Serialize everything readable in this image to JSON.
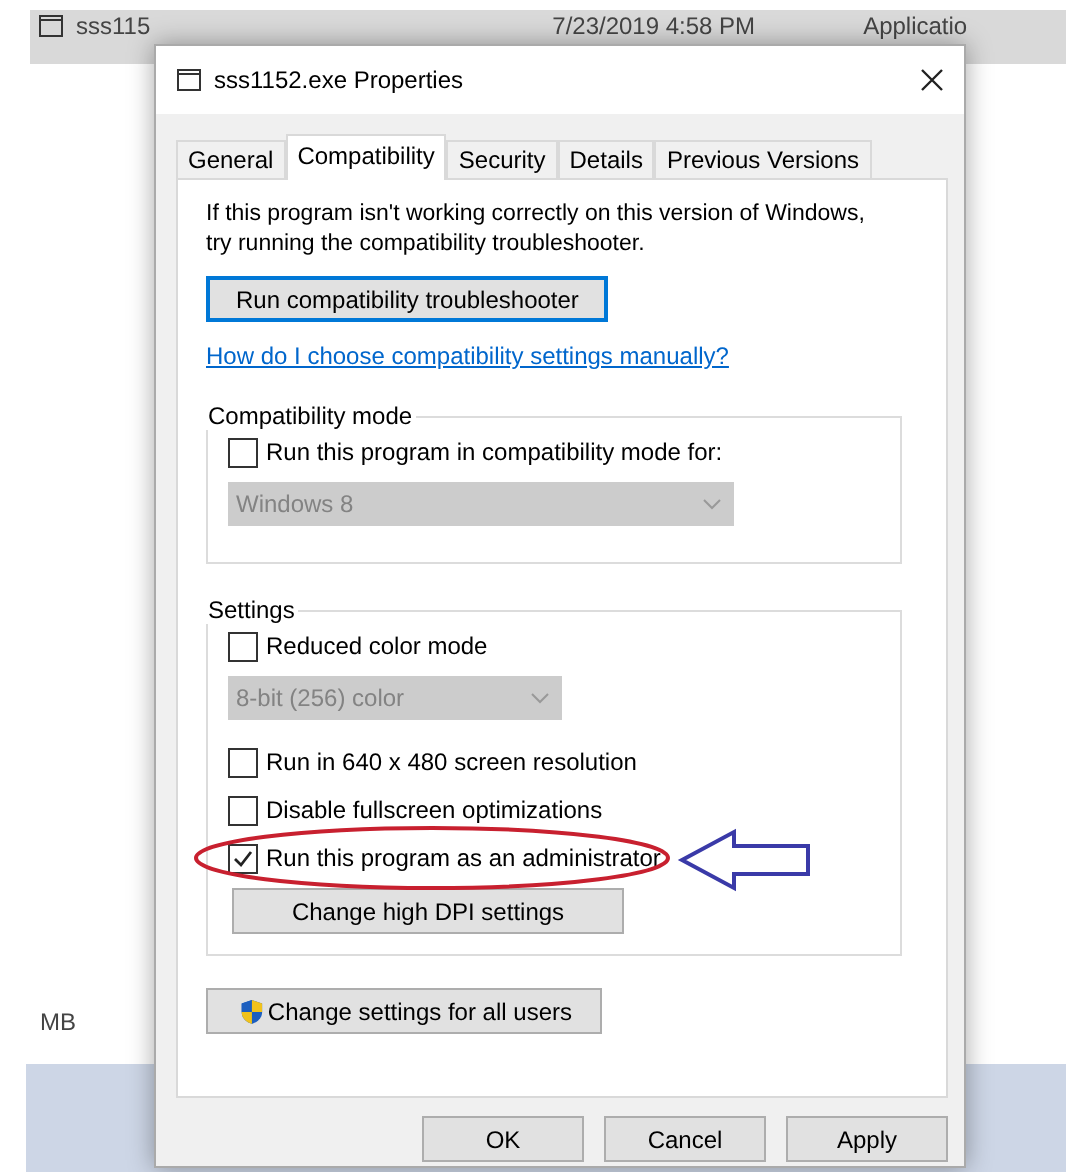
{
  "background": {
    "file_name": "sss115",
    "date_modified": "7/23/2019 4:58 PM",
    "type": "Applicatio",
    "size": "MB"
  },
  "dialog": {
    "title": "sss1152.exe Properties",
    "tabs": [
      {
        "label": "General",
        "selected": false
      },
      {
        "label": "Compatibility",
        "selected": true
      },
      {
        "label": "Security",
        "selected": false
      },
      {
        "label": "Details",
        "selected": false
      },
      {
        "label": "Previous Versions",
        "selected": false
      }
    ],
    "intro": "If this program isn't working correctly on this version of Windows, try running the compatibility troubleshooter.",
    "troubleshooter_button": {
      "label": "Run compatibility troubleshooter",
      "focused": true
    },
    "help_link": "How do I choose compatibility settings manually?",
    "compatibility_mode": {
      "title": "Compatibility mode",
      "checkbox": {
        "label": "Run this program in compatibility mode for:",
        "checked": false
      },
      "dropdown": {
        "value": "Windows 8",
        "disabled": true
      }
    },
    "settings": {
      "title": "Settings",
      "items": [
        {
          "kind": "checkbox",
          "label": "Reduced color mode",
          "checked": false
        },
        {
          "kind": "dropdown",
          "value": "8-bit (256) color",
          "disabled": true
        },
        {
          "kind": "checkbox",
          "label": "Run in 640 x 480 screen resolution",
          "checked": false
        },
        {
          "kind": "checkbox",
          "label": "Disable fullscreen optimizations",
          "checked": false
        },
        {
          "kind": "checkbox",
          "label": "Run this program as an administrator",
          "checked": true
        },
        {
          "kind": "button",
          "label": "Change high DPI settings"
        }
      ]
    },
    "all_users_button": {
      "label": "Change settings for all users"
    },
    "buttons": [
      {
        "label": "OK"
      },
      {
        "label": "Cancel"
      },
      {
        "label": "Apply"
      }
    ]
  }
}
